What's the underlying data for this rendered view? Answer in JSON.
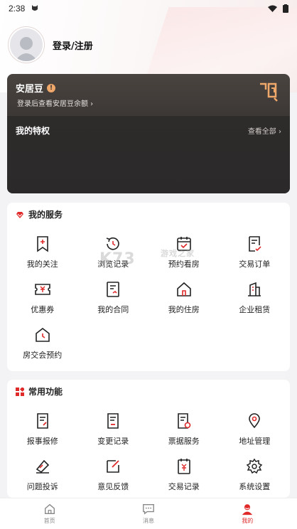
{
  "status": {
    "time": "2:38"
  },
  "profile": {
    "login_label": "登录/注册"
  },
  "bean": {
    "title": "安居豆",
    "subtitle": "登录后查看安居豆余额 ›"
  },
  "privileges": {
    "title": "我的特权",
    "view_all": "查看全部 ›"
  },
  "services": {
    "title": "我的服务",
    "items": [
      {
        "label": "我的关注",
        "icon": "bookmark-add-icon"
      },
      {
        "label": "浏览记录",
        "icon": "history-icon"
      },
      {
        "label": "预约看房",
        "icon": "calendar-check-icon"
      },
      {
        "label": "交易订单",
        "icon": "order-icon"
      },
      {
        "label": "优惠券",
        "icon": "coupon-icon"
      },
      {
        "label": "我的合同",
        "icon": "contract-icon"
      },
      {
        "label": "我的住房",
        "icon": "house-icon"
      },
      {
        "label": "企业租赁",
        "icon": "building-icon"
      },
      {
        "label": "房交会预约",
        "icon": "clock-house-icon"
      }
    ]
  },
  "functions": {
    "title": "常用功能",
    "items": [
      {
        "label": "报事报修",
        "icon": "repair-report-icon"
      },
      {
        "label": "变更记录",
        "icon": "change-record-icon"
      },
      {
        "label": "票据服务",
        "icon": "invoice-icon"
      },
      {
        "label": "地址管理",
        "icon": "location-icon"
      },
      {
        "label": "问题投诉",
        "icon": "complaint-icon"
      },
      {
        "label": "意见反馈",
        "icon": "feedback-icon"
      },
      {
        "label": "交易记录",
        "icon": "transaction-icon"
      },
      {
        "label": "系统设置",
        "icon": "settings-icon"
      }
    ]
  },
  "tabbar": [
    {
      "label": "首页",
      "icon": "home-icon"
    },
    {
      "label": "消息",
      "icon": "message-icon"
    },
    {
      "label": "我的",
      "icon": "profile-icon"
    }
  ],
  "watermark": {
    "text": "K73",
    "sub": "游戏之家"
  },
  "colors": {
    "accent": "#e02a2a",
    "card_dark": "#3a3634",
    "bean_accent": "#f0a86a"
  }
}
